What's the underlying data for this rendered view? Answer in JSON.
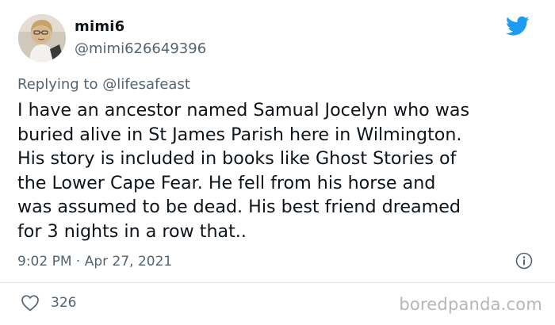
{
  "author": {
    "display_name": "mimi6",
    "handle": "@mimi626649396",
    "avatar": "profile-photo"
  },
  "reply": {
    "prefix": "Replying to ",
    "handle": "@lifesafeast"
  },
  "tweet": {
    "text": "I have an ancestor named Samual Jocelyn who was\nburied alive in St James Parish here in Wilmington.\nHis story is included in books like Ghost Stories of\nthe Lower Cape Fear.  He fell from his horse and\nwas assumed to be dead.  His best friend dreamed\nfor 3 nights in a row that..",
    "timestamp": "9:02 PM · Apr 27, 2021"
  },
  "stats": {
    "likes": "326"
  },
  "icons": {
    "brand": "twitter-bird-icon",
    "info": "info-icon",
    "like": "heart-icon"
  },
  "colors": {
    "twitter_blue": "#1d9bf0",
    "secondary_text": "#536471",
    "watermark": "#b6b6b6"
  },
  "watermark": {
    "text": "boredpanda.com"
  }
}
